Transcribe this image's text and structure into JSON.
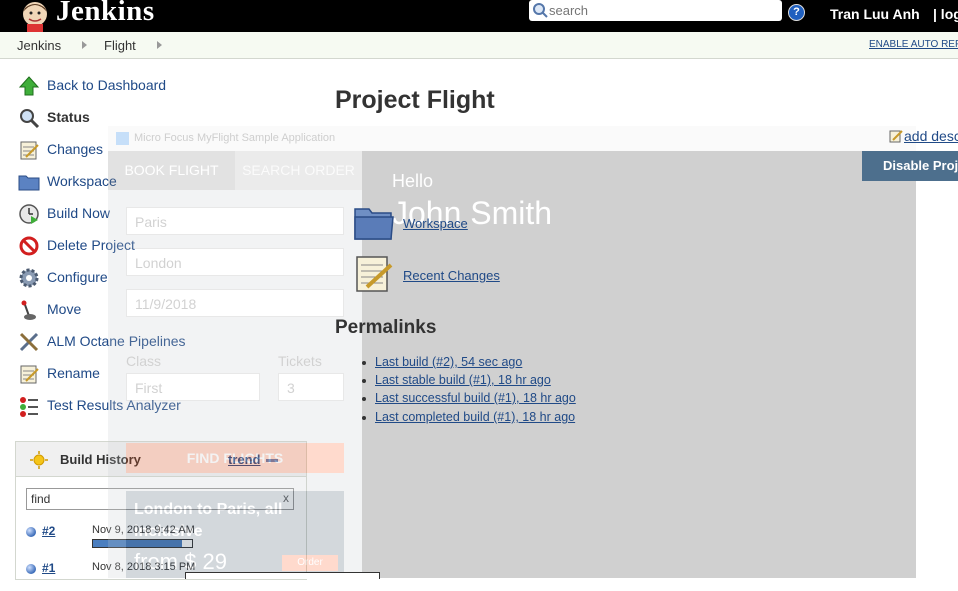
{
  "header": {
    "brand": "Jenkins",
    "search_placeholder": "search",
    "help": "?",
    "user": "Tran Luu Anh",
    "logout": "| log"
  },
  "breadcrumb": {
    "items": [
      "Jenkins",
      "Flight"
    ],
    "auto_refresh": "ENABLE AUTO REFR"
  },
  "tasks": [
    {
      "label": "Back to Dashboard",
      "icon": "up-arrow-icon"
    },
    {
      "label": "Status",
      "icon": "magnifier-icon"
    },
    {
      "label": "Changes",
      "icon": "notepad-icon"
    },
    {
      "label": "Workspace",
      "icon": "folder-icon"
    },
    {
      "label": "Build Now",
      "icon": "clock-play-icon"
    },
    {
      "label": "Delete Project",
      "icon": "no-entry-icon"
    },
    {
      "label": "Configure",
      "icon": "gear-icon"
    },
    {
      "label": "Move",
      "icon": "joystick-icon"
    },
    {
      "label": "ALM Octane Pipelines",
      "icon": "tools-icon"
    },
    {
      "label": "Rename",
      "icon": "notepad-icon"
    },
    {
      "label": "Test Results Analyzer",
      "icon": "analyzer-icon"
    }
  ],
  "build_history": {
    "title": "Build History",
    "trend": "trend",
    "find_value": "find",
    "clear": "x",
    "builds": [
      {
        "number": "#2",
        "date": "Nov 9, 2018 9:42 AM",
        "progress": 0.9
      },
      {
        "number": "#1",
        "date": "Nov 8, 2018 3:15 PM",
        "progress": null
      }
    ]
  },
  "main": {
    "title": "Project Flight",
    "add_description": "add desc",
    "disable_project": "Disable Proje",
    "workspace_link": "Workspace",
    "recent_changes_link": "Recent Changes",
    "permalinks_title": "Permalinks",
    "permalinks": [
      "Last build (#2), 54 sec ago",
      "Last stable build (#1), 18 hr ago",
      "Last successful build (#1), 18 hr ago",
      "Last completed build (#1), 18 hr ago"
    ]
  },
  "overlay_app": {
    "window_title": "Micro Focus MyFlight Sample Application",
    "tab_book": "BOOK FLIGHT",
    "tab_search": "SEARCH ORDER",
    "from": "Paris",
    "to": "London",
    "date": "11/9/2018",
    "class_label": "Class",
    "class_value": "First",
    "tickets_label": "Tickets",
    "tickets_value": "3",
    "find_button": "FIND FLIGHTS",
    "promo_text": "London to Paris, all inclusive",
    "promo_price": "from $ 29",
    "promo_order": "Order",
    "hello": "Hello",
    "user_name": "John Smith"
  },
  "colors": {
    "header_bg": "#000000",
    "link": "#204a87",
    "breadcrumb_bg": "#f6faf2",
    "disable_button": "#4d6f8d"
  }
}
